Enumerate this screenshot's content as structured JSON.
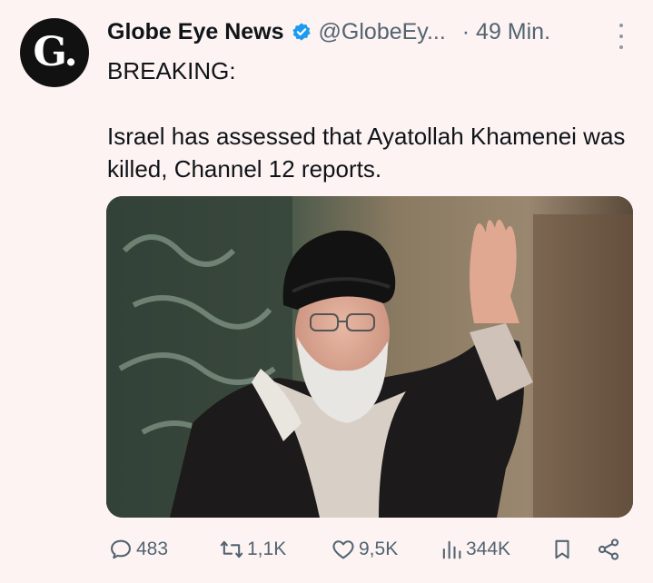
{
  "post": {
    "author": {
      "avatar_letter": "G.",
      "display_name": "Globe Eye News",
      "handle": "@GlobeEy...",
      "verified_icon": "verified-badge-icon",
      "verified_color": "#1d9bf0"
    },
    "time": "· 49 Min.",
    "text": "BREAKING:\n\nIsrael has assessed that Ayatollah Khamenei was killed, Channel 12 reports.",
    "actions": {
      "replies": "483",
      "reposts": "1,1K",
      "likes": "9,5K",
      "views": "344K"
    }
  },
  "icons": [
    "more-options-icon",
    "reply-icon",
    "repost-icon",
    "like-icon",
    "views-icon",
    "bookmark-icon",
    "share-icon"
  ]
}
